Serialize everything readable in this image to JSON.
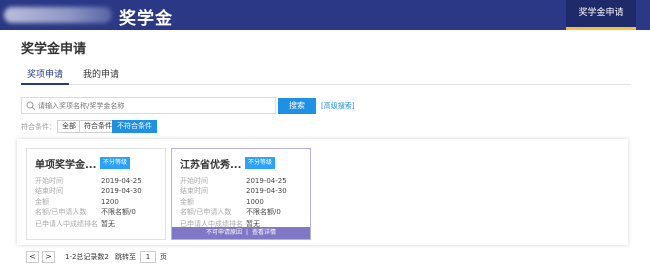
{
  "header": {
    "app_title": "奖学金",
    "nav_item": "奖学金申请"
  },
  "page": {
    "title": "奖学金申请"
  },
  "tabs": [
    {
      "label": "奖项申请"
    },
    {
      "label": "我的申请"
    }
  ],
  "search": {
    "placeholder": "请输入奖项名称/奖学金名称",
    "button_label": "搜索",
    "advanced_label": "[高级搜索]"
  },
  "filters": {
    "label": "符合条件：",
    "options": [
      "全部",
      "符合条件",
      "不符合条件"
    ],
    "selected": "不符合条件"
  },
  "cards": [
    {
      "name": "单项奖学金...",
      "badge": "不分等级",
      "rows": [
        {
          "k": "开始时间",
          "v": "2019-04-25"
        },
        {
          "k": "结束时间",
          "v": "2019-04-30"
        },
        {
          "k": "金额",
          "v": "1200"
        },
        {
          "k": "名额/已申请人数",
          "v": "不限名额/0"
        },
        {
          "k": "已申请人中成绩排名",
          "v": "暂无"
        }
      ]
    },
    {
      "name": "江苏省优秀...",
      "badge": "不分等级",
      "rows": [
        {
          "k": "开始时间",
          "v": "2019-04-25"
        },
        {
          "k": "结束时间",
          "v": "2019-04-30"
        },
        {
          "k": "金额",
          "v": "1000"
        },
        {
          "k": "名额/已申请人数",
          "v": "不限名额/0"
        },
        {
          "k": "已申请人中成绩排名",
          "v": "暂无"
        }
      ],
      "overlay": {
        "reason": "不可申请原因",
        "separator": "|",
        "detail": "查看详情"
      }
    }
  ],
  "pager": {
    "prev": "<",
    "next": ">",
    "info": "1-2总记录数2",
    "jump_label": "跳转至",
    "page": "1",
    "unit": "页"
  },
  "colors": {
    "brand": "#2b3886",
    "accent": "#1e90e6",
    "overlay": "#7a71c4",
    "nav_underline": "#f2c230"
  }
}
